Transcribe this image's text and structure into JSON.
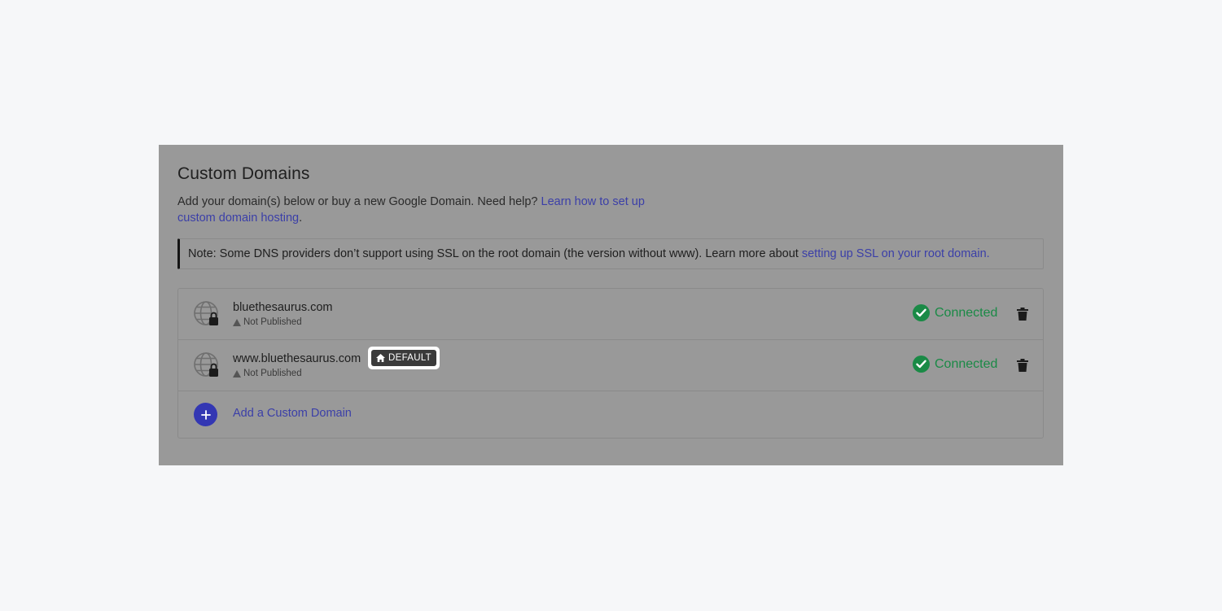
{
  "custom_domains": {
    "title": "Custom Domains",
    "description": "Add your domain(s) below or buy a new Google Domain. Need help?",
    "help_link": "Learn how to set up custom domain hosting",
    "help_link_end": ".",
    "note_text": "Note: Some DNS providers don’t support using SSL on the root domain (the version without www). Learn more about",
    "note_link": "setting up SSL on your root domain."
  },
  "domains": [
    {
      "name": "bluethesaurus.com",
      "publish_status": "Not Published",
      "connection_status": "Connected",
      "default": false,
      "icon": "globe-lock-icon"
    },
    {
      "name": "www.bluethesaurus.com",
      "publish_status": "Not Published",
      "connection_status": "Connected",
      "default": true,
      "badge_label": "DEFAULT",
      "icon": "globe-lock-icon"
    }
  ],
  "add_domain": {
    "label": "Add a Custom Domain"
  },
  "colors": {
    "overlay_panel": "#999999",
    "page_bg": "#f6f7f9",
    "link": "#3b3fa8",
    "connected": "#1a8a46",
    "add_button": "#3337b3"
  }
}
